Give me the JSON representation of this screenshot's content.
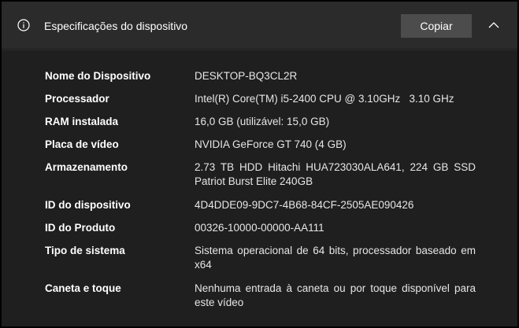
{
  "header": {
    "icon": "info-icon",
    "title": "Especificações do dispositivo",
    "copy_label": "Copiar",
    "collapse_icon": "chevron-up-icon"
  },
  "specs": [
    {
      "label": "Nome do Dispositivo",
      "value": "DESKTOP-BQ3CL2R"
    },
    {
      "label": "Processador",
      "value": "Intel(R) Core(TM) i5-2400 CPU @ 3.10GHz   3.10 GHz"
    },
    {
      "label": "RAM instalada",
      "value": "16,0 GB (utilizável: 15,0 GB)"
    },
    {
      "label": "Placa de vídeo",
      "value": "NVIDIA GeForce GT 740 (4 GB)"
    },
    {
      "label": "Armazenamento",
      "value": "2.73 TB HDD Hitachi HUA723030ALA641, 224 GB SSD Patriot Burst Elite 240GB"
    },
    {
      "label": "ID do dispositivo",
      "value": "4D4DDE09-9DC7-4B68-84CF-2505AE090426"
    },
    {
      "label": "ID do Produto",
      "value": "00326-10000-00000-AA111"
    },
    {
      "label": "Tipo de sistema",
      "value": "Sistema operacional de 64 bits, processador baseado em x64"
    },
    {
      "label": "Caneta e toque",
      "value": "Nenhuma entrada à caneta ou por toque disponível para este vídeo"
    }
  ]
}
